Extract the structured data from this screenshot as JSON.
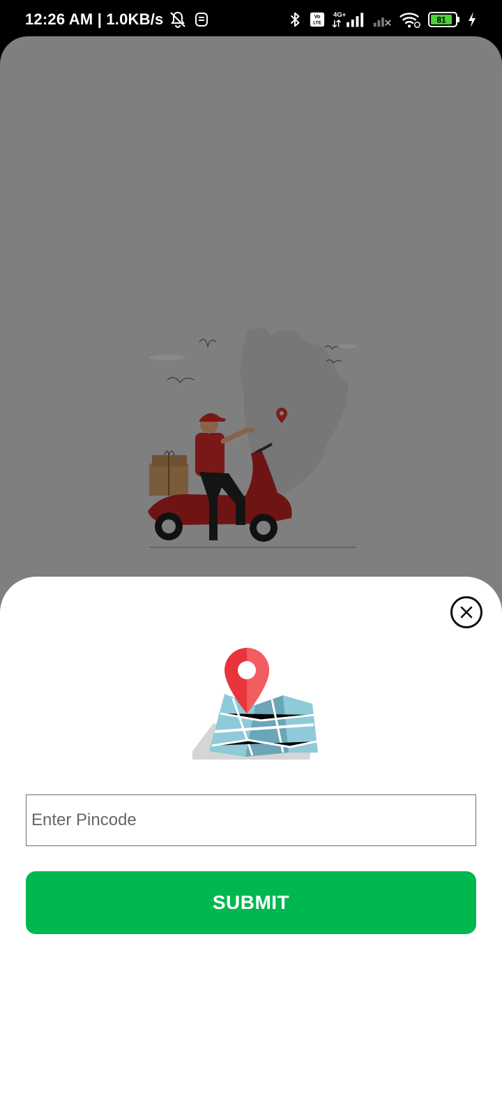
{
  "status_bar": {
    "time_speed": "12:26 AM | 1.0KB/s",
    "network_label": "4G+",
    "volte_label": "Vo LTE",
    "battery_level": "81",
    "icons": [
      "mute-notification-icon",
      "vpn-icon",
      "bluetooth-icon",
      "volte-icon",
      "signal-icon",
      "no-signal-icon",
      "wifi-icon",
      "battery-icon",
      "charging-icon"
    ]
  },
  "background": {
    "illustration": "delivery-scooter-illustration",
    "overlay_color": "#7f7f7f"
  },
  "sheet": {
    "close_icon": "close-circle-icon",
    "illustration": "map-pin-illustration",
    "pincode_input": {
      "value": "",
      "placeholder": "Enter Pincode"
    },
    "submit_label": "SUBMIT",
    "accent_color": "#00b84f"
  }
}
